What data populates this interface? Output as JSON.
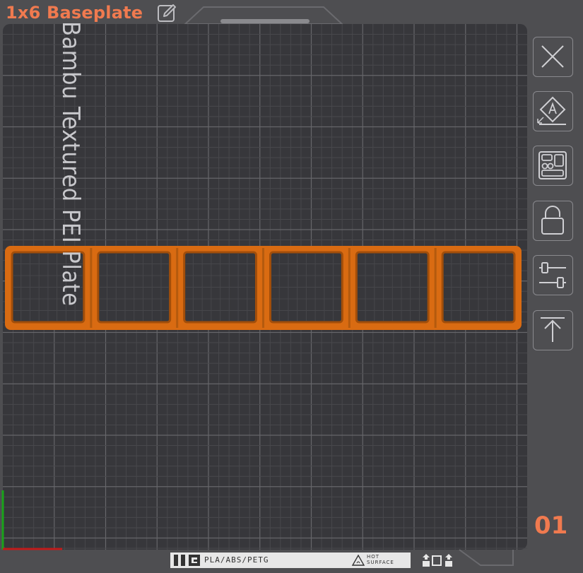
{
  "plate": {
    "title": "1x6 Baseplate",
    "number": "01",
    "bed_type": "Bambu Textured PEI Plate"
  },
  "object": {
    "name": "1x6 Baseplate",
    "cells": 6,
    "color": "#d96b12"
  },
  "toolbar": {
    "items": [
      {
        "name": "close-button",
        "icon": "close-icon"
      },
      {
        "name": "auto-orient-button",
        "icon": "auto-orient-icon"
      },
      {
        "name": "arrange-button",
        "icon": "arrange-icon"
      },
      {
        "name": "lock-button",
        "icon": "lock-icon"
      },
      {
        "name": "plate-settings-button",
        "icon": "sliders-icon"
      },
      {
        "name": "move-to-top-button",
        "icon": "move-to-top-icon"
      }
    ]
  },
  "filament_strip": {
    "materials": "PLA/ABS/PETG",
    "hot_surface_line1": "HOT",
    "hot_surface_line2": "SURFACE"
  },
  "colors": {
    "accent": "#f07a4f",
    "bed": "#37373b",
    "grid": "#5a5a5e",
    "frame": "#4e4e51"
  }
}
